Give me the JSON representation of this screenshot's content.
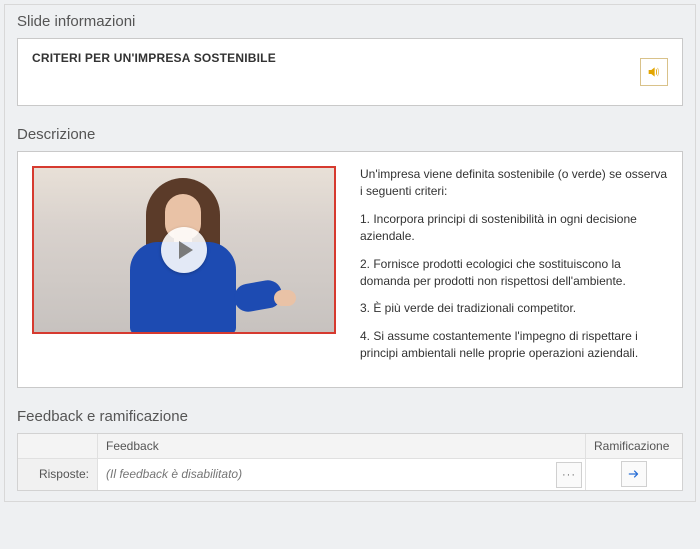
{
  "slideInfo": {
    "sectionTitle": "Slide informazioni",
    "title": "CRITERI PER UN'IMPRESA SOSTENIBILE"
  },
  "description": {
    "sectionTitle": "Descrizione",
    "intro": "Un'impresa viene definita sostenibile (o verde) se osserva i seguenti criteri:",
    "items": [
      "1. Incorpora principi di sostenibilità in ogni decisione aziendale.",
      "2. Fornisce prodotti ecologici che sostituiscono la domanda per prodotti non rispettosi dell'ambiente.",
      "3. È più verde dei tradizionali competitor.",
      "4. Si assume costantemente l'impegno di rispettare i principi ambientali nelle proprie operazioni aziendali."
    ]
  },
  "feedback": {
    "sectionTitle": "Feedback e ramificazione",
    "colFeedback": "Feedback",
    "colRamification": "Ramificazione",
    "rowLabel": "Risposte:",
    "placeholder": "(Il feedback è disabilitato)"
  }
}
